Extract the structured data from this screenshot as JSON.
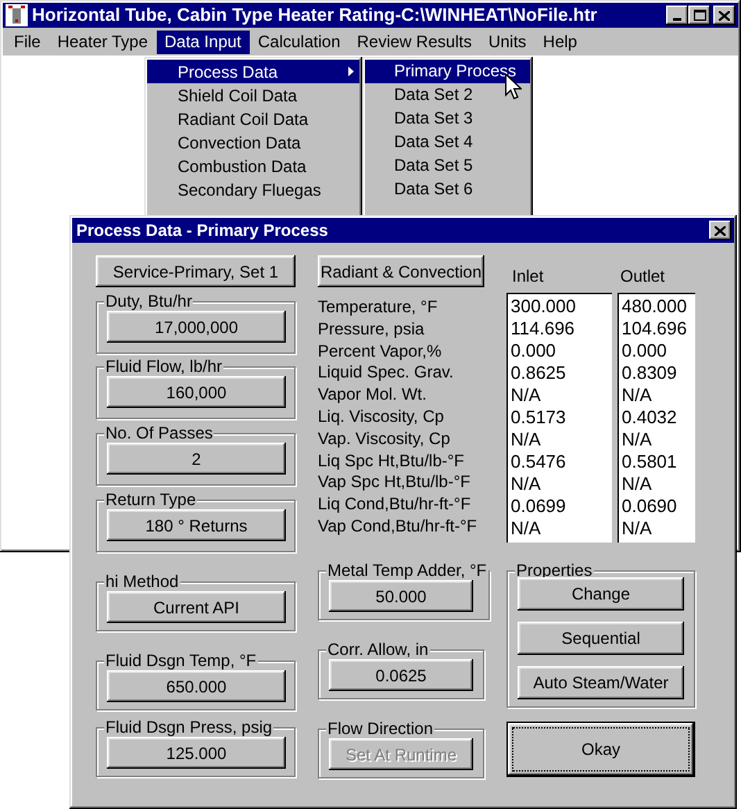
{
  "window": {
    "title": "Horizontal Tube, Cabin Type Heater Rating-C:\\WINHEAT\\NoFile.htr"
  },
  "menu_bar": [
    {
      "label": "File",
      "selected": false
    },
    {
      "label": "Heater Type",
      "selected": false
    },
    {
      "label": "Data Input",
      "selected": true
    },
    {
      "label": "Calculation",
      "selected": false
    },
    {
      "label": "Review Results",
      "selected": false
    },
    {
      "label": "Units",
      "selected": false
    },
    {
      "label": "Help",
      "selected": false
    }
  ],
  "menu": {
    "items": [
      {
        "label": "Process Data",
        "selected": true,
        "submenu": true
      },
      {
        "label": "Shield Coil Data",
        "selected": false,
        "submenu": false
      },
      {
        "label": "Radiant Coil Data",
        "selected": false,
        "submenu": false
      },
      {
        "label": "Convection Data",
        "selected": false,
        "submenu": false
      },
      {
        "label": "Combustion Data",
        "selected": false,
        "submenu": false
      },
      {
        "label": "Secondary Fluegas",
        "selected": false,
        "submenu": false
      }
    ]
  },
  "submenu": {
    "items": [
      {
        "label": "Primary Process",
        "selected": true
      },
      {
        "label": "Data Set 2",
        "selected": false
      },
      {
        "label": "Data Set 3",
        "selected": false
      },
      {
        "label": "Data Set 4",
        "selected": false
      },
      {
        "label": "Data Set 5",
        "selected": false
      },
      {
        "label": "Data Set 6",
        "selected": false
      }
    ]
  },
  "dialog": {
    "title": "Process Data - Primary Process",
    "service_button": "Service-Primary, Set 1",
    "mode_button": "Radiant & Convection",
    "columns": [
      "Inlet",
      "Outlet"
    ],
    "properties": [
      {
        "name": "Temperature, °F",
        "inlet": "300.000",
        "outlet": "480.000"
      },
      {
        "name": "Pressure, psia",
        "inlet": "114.696",
        "outlet": "104.696"
      },
      {
        "name": "Percent Vapor,%",
        "inlet": "0.000",
        "outlet": "0.000"
      },
      {
        "name": "Liquid Spec. Grav.",
        "inlet": "0.8625",
        "outlet": "0.8309"
      },
      {
        "name": "Vapor Mol. Wt.",
        "inlet": "N/A",
        "outlet": "N/A"
      },
      {
        "name": "Liq. Viscosity, Cp",
        "inlet": "0.5173",
        "outlet": "0.4032"
      },
      {
        "name": "Vap. Viscosity, Cp",
        "inlet": "N/A",
        "outlet": "N/A"
      },
      {
        "name": "Liq Spc Ht,Btu/lb-°F",
        "inlet": "0.5476",
        "outlet": "0.5801"
      },
      {
        "name": "Vap Spc Ht,Btu/lb-°F",
        "inlet": "N/A",
        "outlet": "N/A"
      },
      {
        "name": "Liq Cond,Btu/hr-ft-°F",
        "inlet": "0.0699",
        "outlet": "0.0690"
      },
      {
        "name": "Vap Cond,Btu/hr-ft-°F",
        "inlet": "N/A",
        "outlet": "N/A"
      }
    ],
    "top_groups": [
      {
        "label": "Duty, Btu/hr",
        "value": "17,000,000"
      },
      {
        "label": "Fluid Flow, lb/hr",
        "value": "160,000"
      },
      {
        "label": "No. Of Passes",
        "value": "2"
      },
      {
        "label": "Return Type",
        "value": "180 ° Returns"
      }
    ],
    "bottom_left_groups": [
      {
        "label": "hi Method",
        "value": "Current API"
      },
      {
        "label": "Fluid Dsgn Temp, °F",
        "value": "650.000"
      },
      {
        "label": "Fluid Dsgn Press, psig",
        "value": "125.000"
      }
    ],
    "middle_groups": [
      {
        "label": "Metal Temp Adder, °F",
        "value": "50.000",
        "disabled": false
      },
      {
        "label": "Corr. Allow, in",
        "value": "0.0625",
        "disabled": false
      },
      {
        "label": "Flow Direction",
        "value": "Set At Runtime",
        "disabled": true
      }
    ],
    "properties_group": {
      "label": "Properties",
      "buttons": [
        "Change",
        "Sequential",
        "Auto Steam/Water"
      ]
    },
    "ok_button": {
      "label": "Okay",
      "default": true
    }
  }
}
